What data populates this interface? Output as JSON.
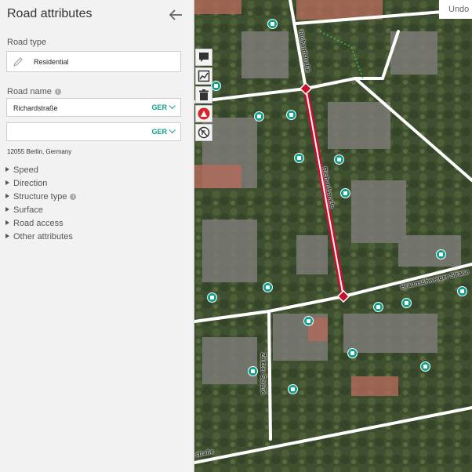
{
  "panel": {
    "title": "Road attributes",
    "back_icon": "arrow-left-icon",
    "road_type": {
      "label": "Road type",
      "value": "Residential"
    },
    "road_name": {
      "label": "Road name",
      "entries": [
        {
          "value": "Richardstraße",
          "lang": "GER"
        },
        {
          "value": "",
          "lang": "GER"
        }
      ]
    },
    "address": "12055 Berlin, Germany",
    "sections": [
      "Speed",
      "Direction",
      "Structure type",
      "Surface",
      "Road access",
      "Other attributes"
    ]
  },
  "map": {
    "undo_label": "Undo",
    "street_labels": [
      "Richardstraße",
      "Richardstraße",
      "Braunschweiger Straße",
      "Zeitzer Straße",
      "straße"
    ],
    "tools": [
      "comment-icon",
      "image-chart-icon",
      "trash-icon",
      "road-work-icon",
      "no-turn-icon"
    ],
    "colors": {
      "selected_road": "#c8102e",
      "poi": "#12a08e",
      "accent": "#12a08e"
    }
  }
}
